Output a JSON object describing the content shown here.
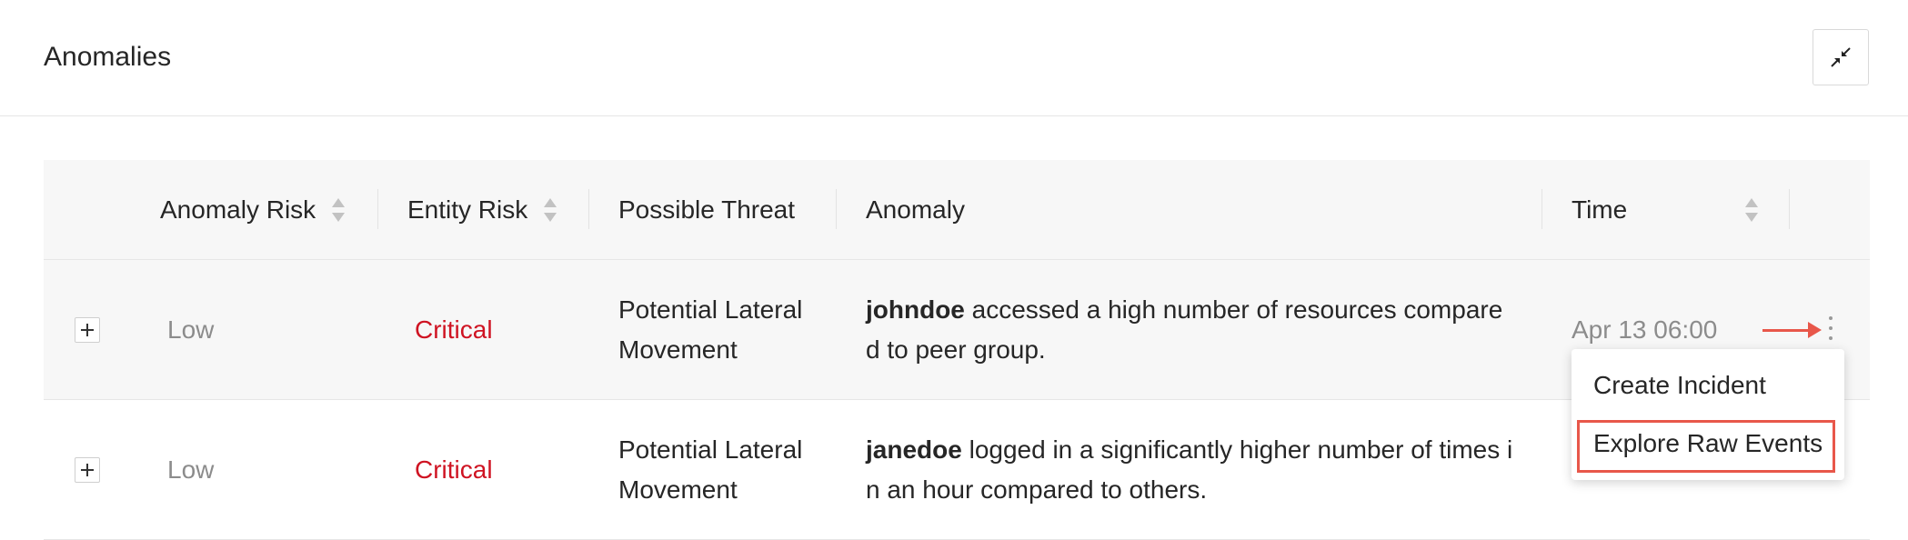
{
  "panel": {
    "title": "Anomalies",
    "collapse_icon": "collapse-arrows-icon"
  },
  "table": {
    "columns": [
      {
        "label": "Anomaly Risk",
        "sortable": true
      },
      {
        "label": "Entity Risk",
        "sortable": true
      },
      {
        "label": "Possible Threat",
        "sortable": false
      },
      {
        "label": "Anomaly",
        "sortable": false
      },
      {
        "label": "Time",
        "sortable": true
      }
    ],
    "rows": [
      {
        "anomaly_risk": "Low",
        "entity_risk": "Critical",
        "threat_line1": "Potential Lateral",
        "threat_line2": "Movement",
        "user": "johndoe",
        "desc_line1": " accessed a high number of resources compare",
        "desc_line2": "d to peer group.",
        "time": "Apr 13 06:00"
      },
      {
        "anomaly_risk": "Low",
        "entity_risk": "Critical",
        "threat_line1": "Potential Lateral",
        "threat_line2": "Movement",
        "user": "janedoe",
        "desc_line1": " logged in a significantly higher number of times i",
        "desc_line2": "n an hour compared to others.",
        "time": ""
      }
    ]
  },
  "actions_menu": {
    "items": [
      "Create Incident",
      "Explore Raw Events"
    ],
    "highlighted": "Explore Raw Events"
  },
  "colors": {
    "critical": "#cf1322",
    "low": "#8c8c8c",
    "annotation": "#e8574a",
    "header_bg": "#f7f7f7"
  }
}
